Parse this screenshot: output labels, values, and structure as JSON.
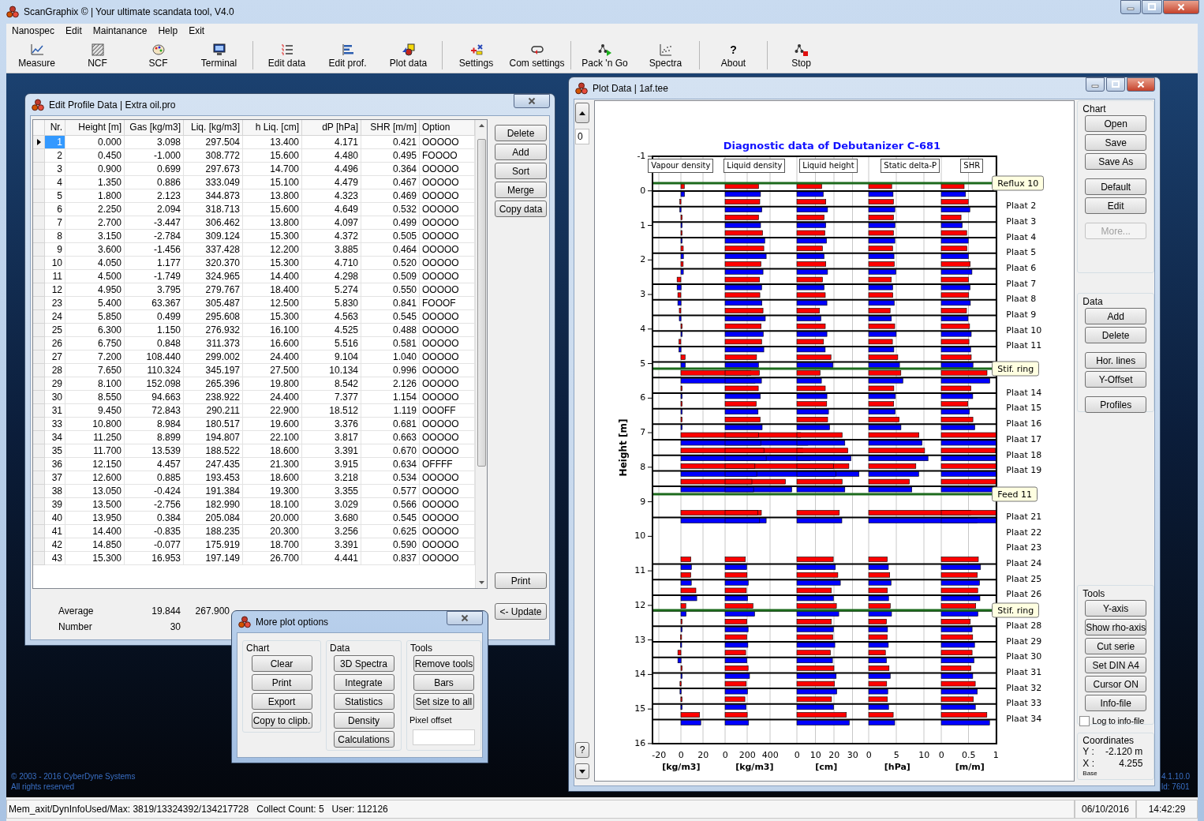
{
  "window": {
    "title": "ScanGraphix © | Your ultimate scandata tool, V4.0"
  },
  "menu": [
    "Nanospec",
    "Edit",
    "Maintanance",
    "Help",
    "Exit"
  ],
  "toolbar": [
    [
      {
        "label": "Measure"
      },
      {
        "label": "NCF"
      },
      {
        "label": "SCF"
      },
      {
        "label": "Terminal"
      }
    ],
    [
      {
        "label": "Edit data"
      },
      {
        "label": "Edit prof."
      },
      {
        "label": "Plot data"
      }
    ],
    [
      {
        "label": "Settings"
      },
      {
        "label": "Com settings"
      }
    ],
    [
      {
        "label": "Pack 'n Go"
      },
      {
        "label": "Spectra"
      }
    ],
    [
      {
        "label": "About",
        "glyph": "?"
      }
    ],
    [
      {
        "label": "Stop"
      }
    ]
  ],
  "edit_profile": {
    "title": "Edit Profile Data | Extra oil.pro",
    "columns": [
      "Nr.",
      "Height [m]",
      "Gas [kg/m3]",
      "Liq. [kg/m3]",
      "h Liq. [cm]",
      "dP [hPa]",
      "SHR [m/m]",
      "Option"
    ],
    "rows": [
      {
        "cells": [
          "1",
          "0.000",
          "3.098",
          "297.504",
          "13.400",
          "4.171",
          "0.421",
          "OOOOO"
        ],
        "selected": true
      },
      {
        "cells": [
          "2",
          "0.450",
          "-1.000",
          "308.772",
          "15.600",
          "4.480",
          "0.495",
          "FOOOO"
        ],
        "selected": false
      },
      {
        "cells": [
          "3",
          "0.900",
          "0.699",
          "297.673",
          "14.700",
          "4.496",
          "0.364",
          "OOOOO"
        ],
        "selected": false
      },
      {
        "cells": [
          "4",
          "1.350",
          "0.886",
          "333.049",
          "15.100",
          "4.479",
          "0.467",
          "OOOOO"
        ],
        "selected": false
      },
      {
        "cells": [
          "5",
          "1.800",
          "2.123",
          "344.873",
          "13.800",
          "4.323",
          "0.469",
          "OOOOO"
        ],
        "selected": false
      },
      {
        "cells": [
          "6",
          "2.250",
          "2.094",
          "318.713",
          "15.600",
          "4.649",
          "0.532",
          "OOOOO"
        ],
        "selected": false
      },
      {
        "cells": [
          "7",
          "2.700",
          "-3.447",
          "306.462",
          "13.800",
          "4.097",
          "0.499",
          "OOOOO"
        ],
        "selected": false
      },
      {
        "cells": [
          "8",
          "3.150",
          "-2.784",
          "309.124",
          "15.300",
          "4.372",
          "0.505",
          "OOOOO"
        ],
        "selected": false
      },
      {
        "cells": [
          "9",
          "3.600",
          "-1.456",
          "337.428",
          "12.200",
          "3.885",
          "0.464",
          "OOOOO"
        ],
        "selected": false
      },
      {
        "cells": [
          "10",
          "4.050",
          "1.177",
          "320.370",
          "15.300",
          "4.710",
          "0.520",
          "OOOOO"
        ],
        "selected": false
      },
      {
        "cells": [
          "11",
          "4.500",
          "-1.749",
          "324.965",
          "14.400",
          "4.298",
          "0.509",
          "OOOOO"
        ],
        "selected": false
      },
      {
        "cells": [
          "12",
          "4.950",
          "3.795",
          "279.767",
          "18.400",
          "5.274",
          "0.550",
          "OOOOO"
        ],
        "selected": false
      },
      {
        "cells": [
          "23",
          "5.400",
          "63.367",
          "305.487",
          "12.500",
          "5.830",
          "0.841",
          "FOOOF"
        ],
        "selected": false
      },
      {
        "cells": [
          "24",
          "5.850",
          "0.499",
          "295.608",
          "15.300",
          "4.563",
          "0.545",
          "OOOOO"
        ],
        "selected": false
      },
      {
        "cells": [
          "25",
          "6.300",
          "1.150",
          "276.932",
          "16.100",
          "4.525",
          "0.488",
          "OOOOO"
        ],
        "selected": false
      },
      {
        "cells": [
          "26",
          "6.750",
          "0.848",
          "311.373",
          "16.600",
          "5.516",
          "0.581",
          "OOOOO"
        ],
        "selected": false
      },
      {
        "cells": [
          "27",
          "7.200",
          "108.440",
          "299.002",
          "24.400",
          "9.104",
          "1.040",
          "OOOOO"
        ],
        "selected": false
      },
      {
        "cells": [
          "28",
          "7.650",
          "110.324",
          "345.197",
          "27.500",
          "10.134",
          "0.996",
          "OOOOO"
        ],
        "selected": false
      },
      {
        "cells": [
          "29",
          "8.100",
          "152.098",
          "265.396",
          "19.800",
          "8.542",
          "2.126",
          "OOOOO"
        ],
        "selected": false
      },
      {
        "cells": [
          "30",
          "8.550",
          "94.663",
          "238.922",
          "24.400",
          "7.377",
          "1.154",
          "OOOOO"
        ],
        "selected": false
      },
      {
        "cells": [
          "31",
          "9.450",
          "72.843",
          "290.211",
          "22.900",
          "18.512",
          "1.119",
          "OOOFF"
        ],
        "selected": false
      },
      {
        "cells": [
          "33",
          "10.800",
          "8.984",
          "180.517",
          "19.600",
          "3.376",
          "0.681",
          "OOOOO"
        ],
        "selected": false
      },
      {
        "cells": [
          "34",
          "11.250",
          "8.899",
          "194.807",
          "22.100",
          "3.817",
          "0.663",
          "OOOOO"
        ],
        "selected": false
      },
      {
        "cells": [
          "35",
          "11.700",
          "13.539",
          "188.522",
          "18.600",
          "3.391",
          "0.670",
          "OOOOO"
        ],
        "selected": false
      },
      {
        "cells": [
          "36",
          "12.150",
          "4.457",
          "247.435",
          "21.300",
          "3.915",
          "0.634",
          "OFFFF"
        ],
        "selected": false
      },
      {
        "cells": [
          "37",
          "12.600",
          "0.885",
          "193.453",
          "18.600",
          "3.218",
          "0.534",
          "OOOOO"
        ],
        "selected": false
      },
      {
        "cells": [
          "38",
          "13.050",
          "-0.424",
          "191.384",
          "19.300",
          "3.355",
          "0.577",
          "OOOOO"
        ],
        "selected": false
      },
      {
        "cells": [
          "39",
          "13.500",
          "-2.756",
          "182.990",
          "18.100",
          "3.029",
          "0.566",
          "OOOOO"
        ],
        "selected": false
      },
      {
        "cells": [
          "40",
          "13.950",
          "0.384",
          "205.084",
          "20.000",
          "3.680",
          "0.545",
          "OOOOO"
        ],
        "selected": false
      },
      {
        "cells": [
          "41",
          "14.400",
          "-0.835",
          "188.235",
          "20.300",
          "3.256",
          "0.625",
          "OOOOO"
        ],
        "selected": false
      },
      {
        "cells": [
          "42",
          "14.850",
          "-0.077",
          "175.919",
          "18.700",
          "3.391",
          "0.590",
          "OOOOO"
        ],
        "selected": false
      },
      {
        "cells": [
          "43",
          "15.300",
          "16.953",
          "197.149",
          "26.700",
          "4.441",
          "0.837",
          "OOOOO"
        ],
        "selected": false
      }
    ],
    "buttons": [
      "Delete",
      "Add",
      "Sort",
      "Merge",
      "Copy data"
    ],
    "print_button": "Print",
    "update_button": "<- Update",
    "summary": [
      {
        "label": "Average",
        "values": [
          "19.844",
          "267.900"
        ]
      },
      {
        "label": "Number",
        "values": [
          "30"
        ]
      }
    ]
  },
  "plot": {
    "title": "Plot Data | 1af.tee",
    "offset_value": "0",
    "help_button": "?",
    "chart": {
      "title": "Diagnostic data of Debutanizer C-681",
      "series_labels": [
        "Vapour density",
        "Liquid density",
        "Liquid height",
        "Static delta-P",
        "SHR"
      ],
      "y_label": "Height [m]",
      "y_ticks": [
        "-1",
        "0",
        "1",
        "2",
        "3",
        "4",
        "5",
        "6",
        "7",
        "8",
        "9",
        "10",
        "11",
        "12",
        "13",
        "14",
        "15",
        "16"
      ],
      "x_axes": [
        {
          "ticks": [
            "-20",
            "0",
            "20"
          ],
          "unit": "[kg/m3]"
        },
        {
          "ticks": [
            "0",
            "200",
            "400"
          ],
          "unit": "[kg/m3]"
        },
        {
          "ticks": [
            "0",
            "10",
            "20",
            "30"
          ],
          "unit": "[cm]"
        },
        {
          "ticks": [
            "0",
            "5",
            "10"
          ],
          "unit": "[hPa]"
        },
        {
          "ticks": [
            "0",
            "0.5",
            "1"
          ],
          "unit": "[m/m]"
        }
      ],
      "plate_labels": [
        "Plaat 2",
        "Plaat 3",
        "Plaat 4",
        "Plaat 5",
        "Plaat 6",
        "Plaat 7",
        "Plaat 8",
        "Plaat 9",
        "Plaat 10",
        "Plaat 11",
        "Plaat 14",
        "Plaat 15",
        "Plaat 16",
        "Plaat 17",
        "Plaat 18",
        "Plaat 19",
        "Plaat 21",
        "Plaat 22",
        "Plaat 23",
        "Plaat 24",
        "Plaat 25",
        "Plaat 26",
        "Plaat 28",
        "Plaat 29",
        "Plaat 30",
        "Plaat 31",
        "Plaat 32",
        "Plaat 33",
        "Plaat 34"
      ],
      "markers": [
        "Reflux 10",
        "Stif. ring",
        "Feed 11",
        "Stif. ring"
      ]
    },
    "panels": [
      {
        "title": "Chart",
        "groups": [
          [
            {
              "label": "Open",
              "disabled": false
            },
            {
              "label": "Save",
              "disabled": false
            },
            {
              "label": "Save As",
              "disabled": false
            }
          ],
          [
            {
              "label": "Default",
              "disabled": false
            },
            {
              "label": "Edit",
              "disabled": false
            }
          ],
          [
            {
              "label": "More...",
              "disabled": true
            }
          ]
        ]
      },
      {
        "title": "Data",
        "groups": [
          [
            {
              "label": "Add",
              "disabled": false
            },
            {
              "label": "Delete",
              "disabled": false
            }
          ],
          [
            {
              "label": "Hor. lines",
              "disabled": false
            },
            {
              "label": "Y-Offset",
              "disabled": false
            }
          ],
          [
            {
              "label": "Profiles",
              "disabled": false
            }
          ]
        ]
      },
      {
        "title": "Tools",
        "groups": [
          [
            {
              "label": "Y-axis",
              "disabled": false
            },
            {
              "label": "Show rho-axis",
              "disabled": false
            },
            {
              "label": "Cut serie",
              "disabled": false
            },
            {
              "label": "Set DIN A4",
              "disabled": false
            },
            {
              "label": "Cursor ON",
              "disabled": false
            },
            {
              "label": "Info-file",
              "disabled": false
            }
          ]
        ],
        "checkbox": {
          "label": "Log to info-file",
          "checked": false
        }
      }
    ],
    "coordinates": {
      "title": "Coordinates",
      "rows": [
        {
          "axis": "Y :",
          "value": "-2.120 m"
        },
        {
          "axis": "X :",
          "value": "4.255"
        }
      ],
      "note": "Base"
    }
  },
  "plot_options": {
    "title": "More plot options",
    "groups": [
      {
        "title": "Chart",
        "buttons": [
          "Clear",
          "Print",
          "Export",
          "Copy to clipb."
        ]
      },
      {
        "title": "Data",
        "buttons": [
          "3D Spectra",
          "Integrate",
          "Statistics",
          "Density",
          "Calculations"
        ]
      },
      {
        "title": "Tools",
        "buttons": [
          "Remove tools",
          "Bars",
          "Set size to all"
        ],
        "field_label": "Pixel offset"
      }
    ]
  },
  "footer": {
    "copyright": "© 2003 - 2016 CyberDyne Systems",
    "rights": "All rights reserved",
    "version": "4.1.10.0",
    "build": "ld: 7601"
  },
  "status_bar": [
    "Mem_axit/DynInfoUsed/Max: 3819/13324392/134217728",
    "Collect Count: 5",
    "User: 112126",
    "06/10/2016",
    "14:42:29"
  ]
}
